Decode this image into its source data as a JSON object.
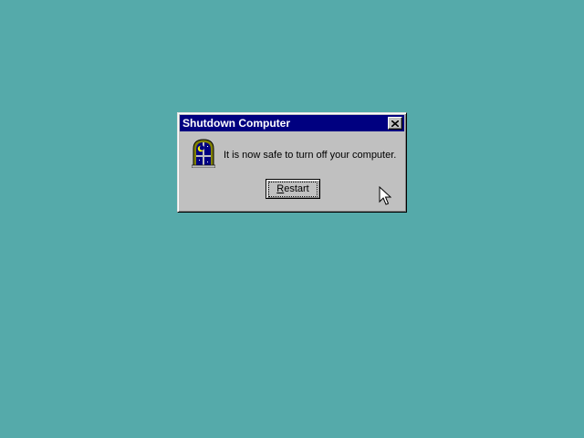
{
  "desktop": {
    "background_color": "#55aaaa"
  },
  "dialog": {
    "title": "Shutdown Computer",
    "message": "It is now safe to turn off your computer.",
    "icon": "night-window-icon",
    "close_icon": "close-icon",
    "button": {
      "label_first": "R",
      "label_rest": "estart"
    },
    "titlebar_color": "#000080"
  },
  "cursor": {
    "icon": "mouse-pointer-icon"
  }
}
